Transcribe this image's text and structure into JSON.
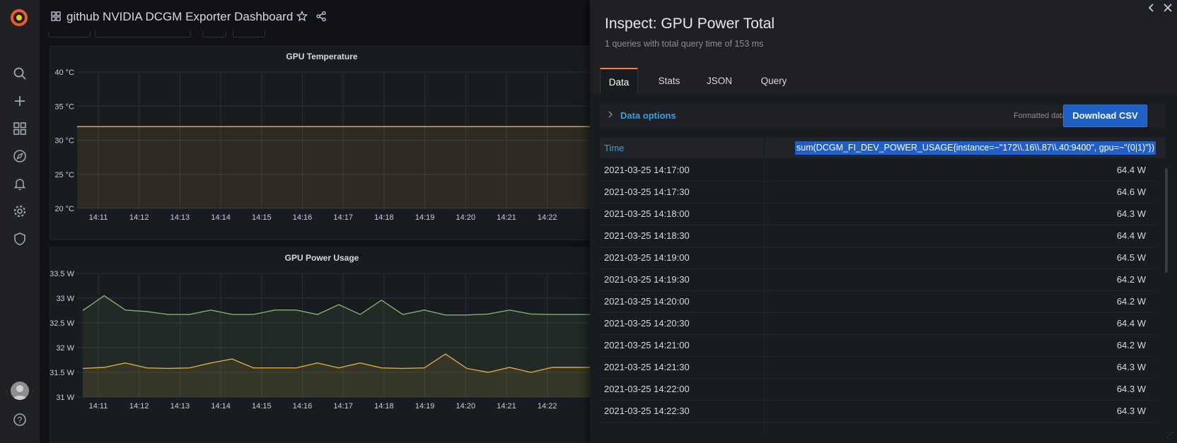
{
  "dashboard": {
    "title": "github NVIDIA DCGM Exporter Dashboard",
    "icons": [
      "dashboards-grid-icon",
      "star-icon",
      "share-icon"
    ]
  },
  "sidebar": {
    "icons": [
      "grafana-logo",
      "search-icon",
      "plus-icon",
      "dashboards-icon",
      "explore-compass-icon",
      "alerting-bell-icon",
      "configuration-gear-icon",
      "server-admin-shield-icon",
      "user-avatar",
      "help-icon"
    ]
  },
  "panels": {
    "temperature": {
      "title": "GPU Temperature",
      "y_ticks": [
        "40 °C",
        "35 °C",
        "30 °C",
        "25 °C",
        "20 °C"
      ],
      "x_ticks": [
        "14:11",
        "14:12",
        "14:13",
        "14:14",
        "14:15",
        "14:16",
        "14:17",
        "14:18",
        "14:19",
        "14:20",
        "14:21",
        "14:22"
      ]
    },
    "power": {
      "title": "GPU Power Usage",
      "y_ticks": [
        "33.5 W",
        "33 W",
        "32.5 W",
        "32 W",
        "31.5 W",
        "31 W"
      ],
      "x_ticks": [
        "14:11",
        "14:12",
        "14:13",
        "14:14",
        "14:15",
        "14:16",
        "14:17",
        "14:18",
        "14:19",
        "14:20",
        "14:21",
        "14:22"
      ]
    }
  },
  "chart_data": [
    {
      "type": "line",
      "title": "GPU Temperature",
      "xlabel": "",
      "ylabel": "",
      "ylim": [
        20,
        40
      ],
      "grid": true,
      "x": [
        "14:11",
        "14:12",
        "14:13",
        "14:14",
        "14:15",
        "14:16",
        "14:17",
        "14:18",
        "14:19",
        "14:20",
        "14:21",
        "14:22"
      ],
      "series": [
        {
          "color": "#eab839",
          "values": [
            32,
            32,
            32,
            32,
            32,
            32,
            32,
            32,
            32,
            32,
            32,
            32
          ]
        }
      ]
    },
    {
      "type": "line",
      "title": "GPU Power Usage",
      "xlabel": "",
      "ylabel": "",
      "ylim": [
        31,
        33.5
      ],
      "grid": true,
      "x_range": [
        "14:10:30",
        "14:22:30"
      ],
      "series": [
        {
          "color": "#7eb26d",
          "values": [
            32.75,
            33.05,
            32.76,
            32.73,
            32.67,
            32.67,
            32.76,
            32.67,
            32.67,
            32.76,
            32.76,
            32.67,
            32.87,
            32.67,
            32.96,
            32.67,
            32.76,
            32.66,
            32.66,
            32.68,
            32.76,
            32.68,
            32.67,
            32.67,
            32.67
          ]
        },
        {
          "color": "#e0a93a",
          "values": [
            31.58,
            31.6,
            31.69,
            31.59,
            31.58,
            31.59,
            31.69,
            31.77,
            31.59,
            31.59,
            31.59,
            31.69,
            31.59,
            31.69,
            31.59,
            31.58,
            31.59,
            31.87,
            31.58,
            31.5,
            31.6,
            31.5,
            31.6,
            31.6,
            31.6
          ]
        }
      ]
    },
    {
      "type": "table",
      "columns": [
        "Time",
        "sum(DCGM_FI_DEV_POWER_USAGE{instance=~\"172\\\\.16\\\\.87\\\\.40:9400\", gpu=~\"(0|1)\"})"
      ],
      "rows": [
        [
          "2021-03-25 14:17:00",
          "64.4 W"
        ],
        [
          "2021-03-25 14:17:30",
          "64.6 W"
        ],
        [
          "2021-03-25 14:18:00",
          "64.3 W"
        ],
        [
          "2021-03-25 14:18:30",
          "64.4 W"
        ],
        [
          "2021-03-25 14:19:00",
          "64.5 W"
        ],
        [
          "2021-03-25 14:19:30",
          "64.2 W"
        ],
        [
          "2021-03-25 14:20:00",
          "64.2 W"
        ],
        [
          "2021-03-25 14:20:30",
          "64.4 W"
        ],
        [
          "2021-03-25 14:21:00",
          "64.2 W"
        ],
        [
          "2021-03-25 14:21:30",
          "64.3 W"
        ],
        [
          "2021-03-25 14:22:00",
          "64.3 W"
        ],
        [
          "2021-03-25 14:22:30",
          "64.3 W"
        ]
      ]
    }
  ],
  "inspect": {
    "title": "Inspect: GPU Power Total",
    "subtitle": "1 queries with total query time of 153 ms",
    "tabs": [
      {
        "label": "Data",
        "active": true
      },
      {
        "label": "Stats",
        "active": false
      },
      {
        "label": "JSON",
        "active": false
      },
      {
        "label": "Query",
        "active": false
      }
    ],
    "data_options_label": "Data options",
    "formatted_data_label": "Formatted data",
    "download_label": "Download CSV",
    "table": {
      "time_header": "Time",
      "value_header": "sum(DCGM_FI_DEV_POWER_USAGE{instance=~\"172\\\\.16\\\\.87\\\\.40:9400\", gpu=~\"(0|1)\"})",
      "rows": [
        {
          "time": "2021-03-25 14:17:00",
          "value": "64.4 W"
        },
        {
          "time": "2021-03-25 14:17:30",
          "value": "64.6 W"
        },
        {
          "time": "2021-03-25 14:18:00",
          "value": "64.3 W"
        },
        {
          "time": "2021-03-25 14:18:30",
          "value": "64.4 W"
        },
        {
          "time": "2021-03-25 14:19:00",
          "value": "64.5 W"
        },
        {
          "time": "2021-03-25 14:19:30",
          "value": "64.2 W"
        },
        {
          "time": "2021-03-25 14:20:00",
          "value": "64.2 W"
        },
        {
          "time": "2021-03-25 14:20:30",
          "value": "64.4 W"
        },
        {
          "time": "2021-03-25 14:21:00",
          "value": "64.2 W"
        },
        {
          "time": "2021-03-25 14:21:30",
          "value": "64.3 W"
        },
        {
          "time": "2021-03-25 14:22:00",
          "value": "64.3 W"
        },
        {
          "time": "2021-03-25 14:22:30",
          "value": "64.3 W"
        }
      ]
    }
  }
}
